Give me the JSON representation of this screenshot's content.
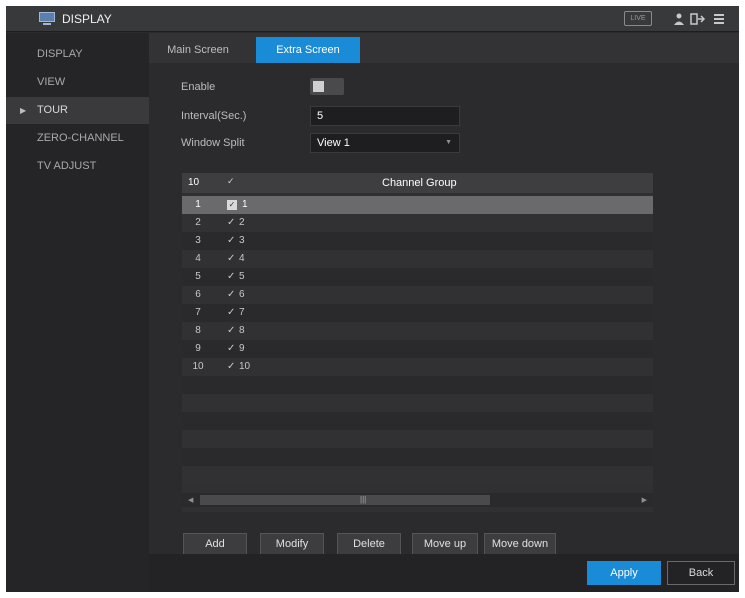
{
  "window": {
    "title": "DISPLAY",
    "live_label": "LIVE",
    "icons": [
      "monitor-icon",
      "user-icon",
      "logout-icon",
      "menu-icon"
    ]
  },
  "sidebar": {
    "items": [
      {
        "label": "DISPLAY",
        "active": false
      },
      {
        "label": "VIEW",
        "active": false
      },
      {
        "label": "TOUR",
        "active": true
      },
      {
        "label": "ZERO-CHANNEL",
        "active": false
      },
      {
        "label": "TV ADJUST",
        "active": false
      }
    ]
  },
  "tabs": [
    {
      "label": "Main Screen",
      "active": false
    },
    {
      "label": "Extra Screen",
      "active": true
    }
  ],
  "form": {
    "enable_label": "Enable",
    "interval_label": "Interval(Sec.)",
    "interval_value": "5",
    "window_split_label": "Window Split",
    "window_split_value": "View 1"
  },
  "table": {
    "header": {
      "count": "10",
      "check": "✓",
      "group": "Channel Group"
    },
    "rows": [
      {
        "num": "1",
        "check": "☑",
        "group": "1",
        "selected": true
      },
      {
        "num": "2",
        "check": "✓",
        "group": "2"
      },
      {
        "num": "3",
        "check": "✓",
        "group": "3"
      },
      {
        "num": "4",
        "check": "✓",
        "group": "4"
      },
      {
        "num": "5",
        "check": "✓",
        "group": "5"
      },
      {
        "num": "6",
        "check": "✓",
        "group": "6"
      },
      {
        "num": "7",
        "check": "✓",
        "group": "7"
      },
      {
        "num": "8",
        "check": "✓",
        "group": "8"
      },
      {
        "num": "9",
        "check": "✓",
        "group": "9"
      },
      {
        "num": "10",
        "check": "✓",
        "group": "10"
      }
    ],
    "scrollbar": {
      "left": "◀",
      "grip": "|||",
      "right": "▶"
    }
  },
  "buttons": {
    "add": "Add",
    "modify": "Modify",
    "delete": "Delete",
    "move_up": "Move up",
    "move_down": "Move down",
    "apply": "Apply",
    "back": "Back"
  },
  "colors": {
    "accent": "#1a8bd6",
    "background": "#2b2b2d",
    "sidebar": "#252527",
    "selected_row": "#6a6a6c"
  }
}
